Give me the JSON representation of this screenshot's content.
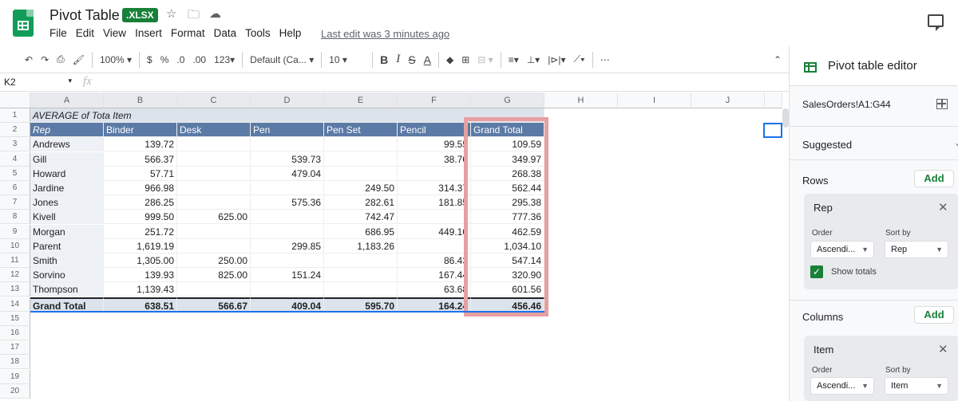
{
  "header": {
    "title": "Pivot Table",
    "badge": "XLSX",
    "last_edit": "Last edit was 3 minutes ago",
    "menu": [
      "File",
      "Edit",
      "View",
      "Insert",
      "Format",
      "Data",
      "Tools",
      "Help"
    ]
  },
  "toolbar": {
    "zoom": "100%",
    "currency": "$",
    "percent": "%",
    "dec_decrease": ".0",
    "dec_increase": ".00",
    "more_formats": "123",
    "font": "Default (Ca...",
    "font_size": "10",
    "bold": "B",
    "italic": "I",
    "strike": "S",
    "text_color": "A",
    "more": "⋯"
  },
  "formula_bar": {
    "name_box": "K2",
    "fx": "fx",
    "value": ""
  },
  "grid": {
    "columns": [
      "A",
      "B",
      "C",
      "D",
      "E",
      "F",
      "G",
      "H",
      "I",
      "J"
    ],
    "row_numbers": [
      "1",
      "2",
      "3",
      "4",
      "5",
      "6",
      "7",
      "8",
      "9",
      "10",
      "11",
      "12",
      "13",
      "14",
      "15",
      "16",
      "17",
      "18",
      "19",
      "20"
    ],
    "pivot_title": "AVERAGE of Tota Item",
    "headers": [
      "Rep",
      "Binder",
      "Desk",
      "Pen",
      "Pen Set",
      "Pencil",
      "Grand Total"
    ],
    "rows": [
      [
        "Andrews",
        "139.72",
        "",
        "",
        "",
        "99.55",
        "109.59"
      ],
      [
        "Gill",
        "566.37",
        "",
        "539.73",
        "",
        "38.70",
        "349.97"
      ],
      [
        "Howard",
        "57.71",
        "",
        "479.04",
        "",
        "",
        "268.38"
      ],
      [
        "Jardine",
        "966.98",
        "",
        "",
        "249.50",
        "314.37",
        "562.44"
      ],
      [
        "Jones",
        "286.25",
        "",
        "575.36",
        "282.61",
        "181.85",
        "295.38"
      ],
      [
        "Kivell",
        "999.50",
        "625.00",
        "",
        "742.47",
        "",
        "777.36"
      ],
      [
        "Morgan",
        "251.72",
        "",
        "",
        "686.95",
        "449.10",
        "462.59"
      ],
      [
        "Parent",
        "1,619.19",
        "",
        "299.85",
        "1,183.26",
        "",
        "1,034.10"
      ],
      [
        "Smith",
        "1,305.00",
        "250.00",
        "",
        "",
        "86.43",
        "547.14"
      ],
      [
        "Sorvino",
        "139.93",
        "825.00",
        "151.24",
        "",
        "167.44",
        "320.90"
      ],
      [
        "Thompson",
        "1,139.43",
        "",
        "",
        "",
        "63.68",
        "601.56"
      ]
    ],
    "grand_total": [
      "Grand Total",
      "638.51",
      "566.67",
      "409.04",
      "595.70",
      "164.24",
      "456.46"
    ]
  },
  "panel": {
    "title": "Pivot table editor",
    "range": "SalesOrders!A1:G44",
    "suggested": "Suggested",
    "rows_label": "Rows",
    "columns_label": "Columns",
    "add": "Add",
    "row_card": {
      "title": "Rep",
      "order_label": "Order",
      "order_value": "Ascendi...",
      "sortby_label": "Sort by",
      "sortby_value": "Rep",
      "show_totals": "Show totals"
    },
    "col_card": {
      "title": "Item",
      "order_label": "Order",
      "order_value": "Ascendi...",
      "sortby_label": "Sort by",
      "sortby_value": "Item"
    }
  }
}
